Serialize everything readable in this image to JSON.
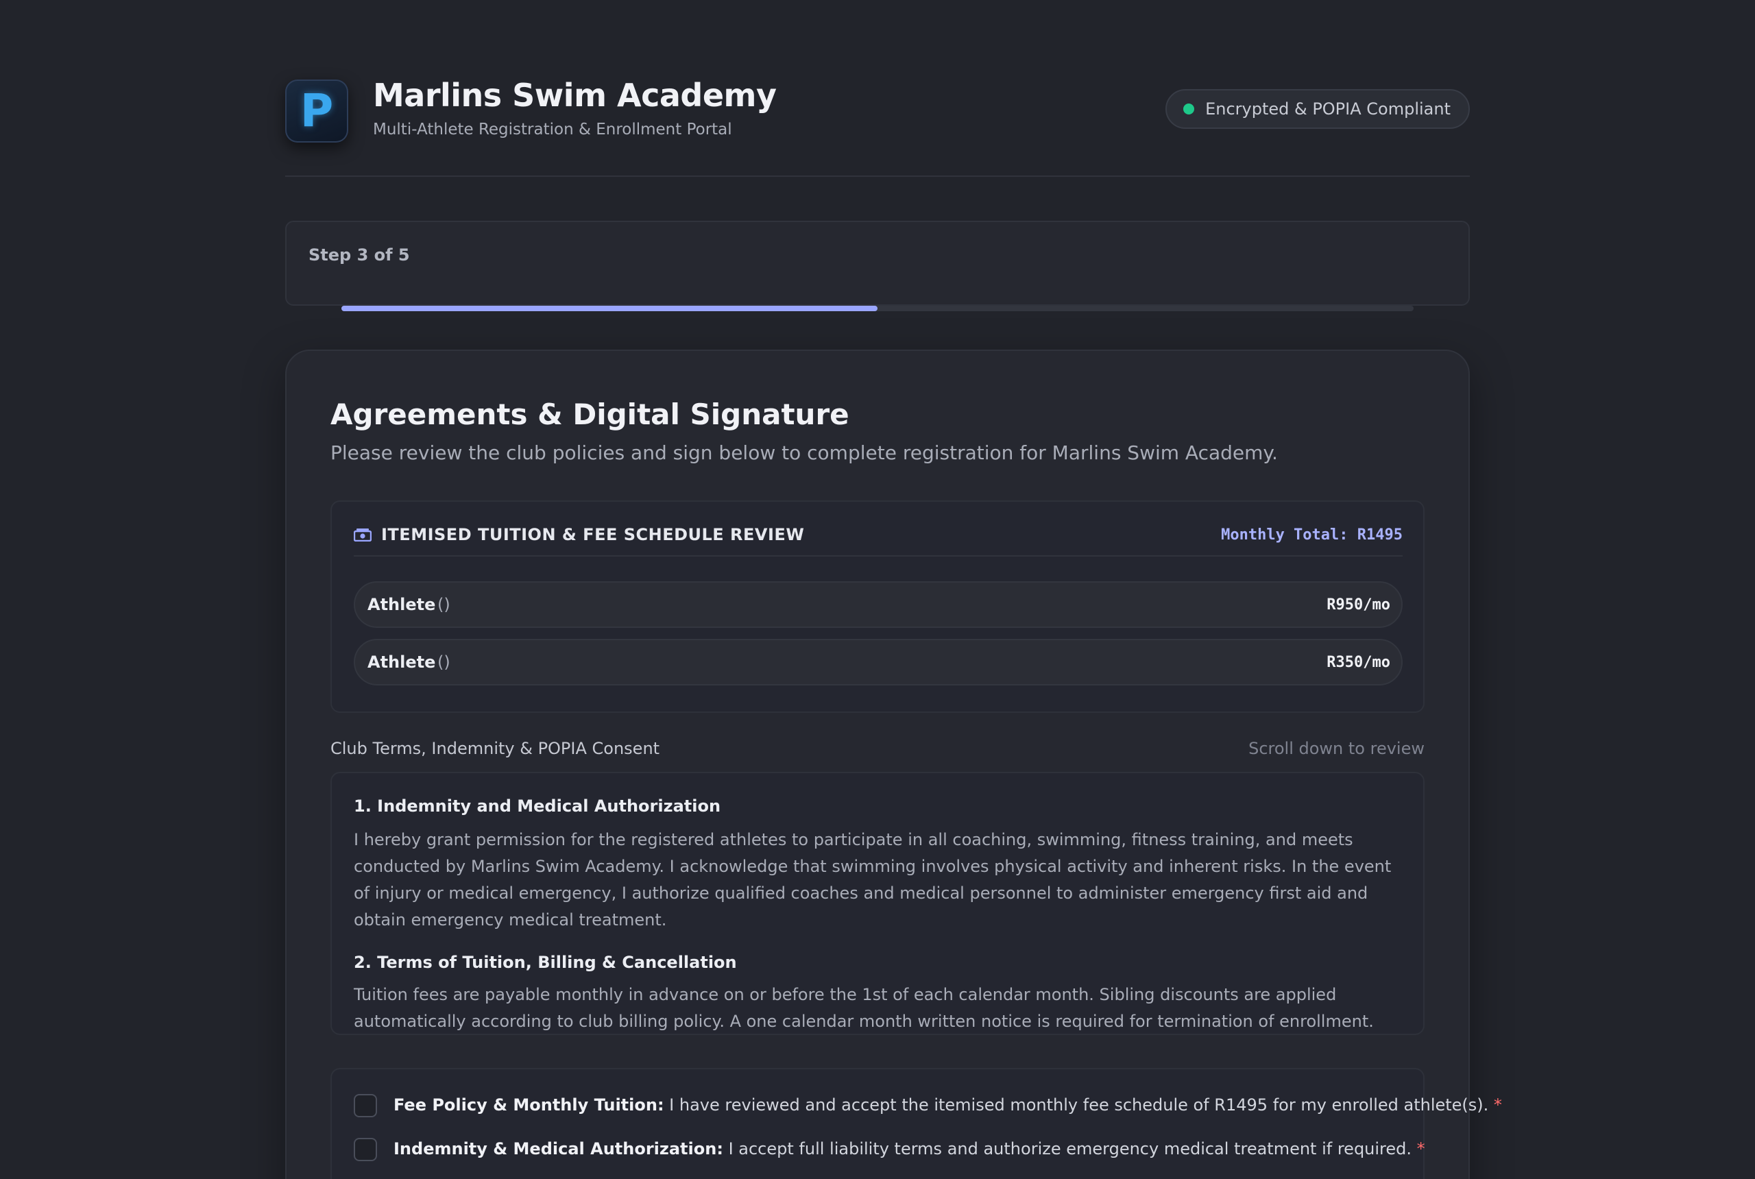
{
  "header": {
    "logo_letter": "P",
    "title": "Marlins Swim Academy",
    "subtitle": "Multi-Athlete Registration & Enrollment Portal",
    "badge": "Encrypted & POPIA Compliant"
  },
  "progress": {
    "step_label": "Step 3 of 5",
    "fraction": 0.5
  },
  "section": {
    "title": "Agreements & Digital Signature",
    "subtitle": "Please review the club policies and sign below to complete registration for Marlins Swim Academy."
  },
  "fees": {
    "heading": "ITEMISED TUITION & FEE SCHEDULE REVIEW",
    "total": "Monthly Total: R1495",
    "rows": [
      {
        "name": "Athlete",
        "detail": "()",
        "price": "R950/mo"
      },
      {
        "name": "Athlete",
        "detail": "()",
        "price": "R350/mo"
      }
    ]
  },
  "terms": {
    "label": "Club Terms, Indemnity & POPIA Consent",
    "hint": "Scroll down to review",
    "sections": [
      {
        "heading": "1. Indemnity and Medical Authorization",
        "body": "I hereby grant permission for the registered athletes to participate in all coaching, swimming, fitness training, and meets conducted by Marlins Swim Academy. I acknowledge that swimming involves physical activity and inherent risks. In the event of injury or medical emergency, I authorize qualified coaches and medical personnel to administer emergency first aid and obtain emergency medical treatment."
      },
      {
        "heading": "2. Terms of Tuition, Billing & Cancellation",
        "body": "Tuition fees are payable monthly in advance on or before the 1st of each calendar month. Sibling discounts are applied automatically according to club billing policy. A one calendar month written notice is required for termination of enrollment."
      }
    ]
  },
  "consents": [
    {
      "title": "Fee Policy & Monthly Tuition:",
      "text": " I have reviewed and accept the itemised monthly fee schedule of R1495 for my enrolled athlete(s).",
      "required": " *"
    },
    {
      "title": "Indemnity & Medical Authorization:",
      "text": " I accept full liability terms and authorize emergency medical treatment if required.",
      "required": " *"
    }
  ],
  "colors": {
    "background": "#22242b",
    "card": "#262830",
    "accent": "#9aa6ff",
    "status_ok": "#1ec98a",
    "required": "#ff6b6b"
  },
  "icons": {
    "fee_icon": "money-icon",
    "badge_icon": "status-dot-icon"
  }
}
